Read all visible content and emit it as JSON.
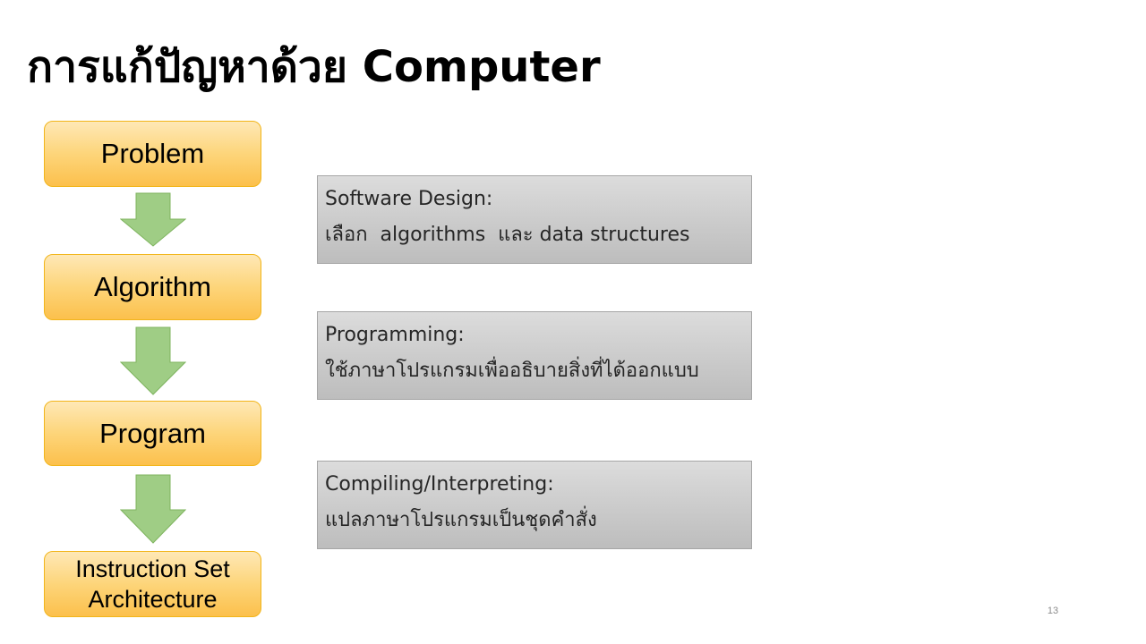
{
  "title": "การแก้ปัญหาด้วย Computer",
  "flow": {
    "steps": [
      "Problem",
      "Algorithm",
      "Program",
      "Instruction Set\nArchitecture"
    ]
  },
  "descriptions": [
    {
      "heading": "Software Design:",
      "text": "เลือก  algorithms  และ data structures"
    },
    {
      "heading": "Programming:",
      "text": "ใช้ภาษาโปรแกรมเพื่ออธิบายสิ่งที่ได้ออกแบบ"
    },
    {
      "heading": "Compiling/Interpreting:",
      "text": "แปลภาษาโปรแกรมเป็นชุดคำสั่ง"
    }
  ],
  "page_number": "13",
  "colors": {
    "step_fill": "#fdd57a",
    "step_border": "#f2b51a",
    "arrow_fill": "#9fcd85",
    "arrow_border": "#7fb45f",
    "desc_fill": "#c9c9c9",
    "desc_border": "#a6a6a6"
  },
  "icons": {
    "flow_arrow": "arrow-down-icon"
  }
}
